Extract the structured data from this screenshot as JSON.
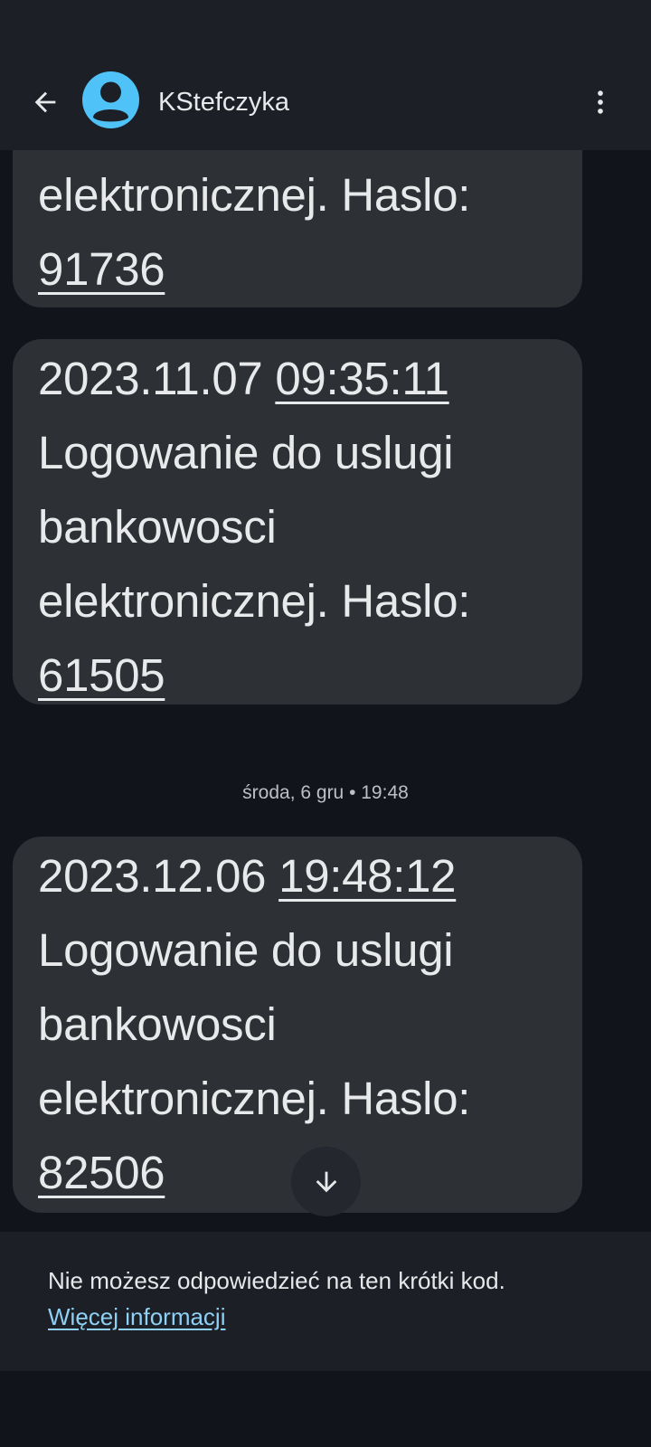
{
  "header": {
    "contact_name": "KStefczyka",
    "avatar_color": "#4fc3f7",
    "icons": {
      "back": "arrow-back-icon",
      "more": "more-vert-icon",
      "avatar": "person-icon"
    }
  },
  "messages": [
    {
      "lines": [
        "elektronicznej. Haslo:"
      ],
      "code": "91736"
    },
    {
      "date": "2023.11.07",
      "time": "09:35:11",
      "lines": [
        "Logowanie do uslugi",
        "bankowosci",
        "elektronicznej. Haslo:"
      ],
      "code": "61505"
    },
    {
      "date": "2023.12.06",
      "time": "19:48:12",
      "lines": [
        "Logowanie do uslugi",
        "bankowosci",
        "elektronicznej. Haslo:"
      ],
      "code": "82506"
    }
  ],
  "date_separator": "środa, 6 gru • 19:48",
  "scroll_down_icon": "arrow-down-icon",
  "footer": {
    "notice": "Nie możesz odpowiedzieć na ten krótki kod.",
    "link": "Więcej informacji",
    "link_color": "#8fd0f5"
  },
  "colors": {
    "background": "#11151b",
    "app_bar": "#1c2026",
    "bubble": "#2d3034",
    "text": "#e8e9eb"
  }
}
